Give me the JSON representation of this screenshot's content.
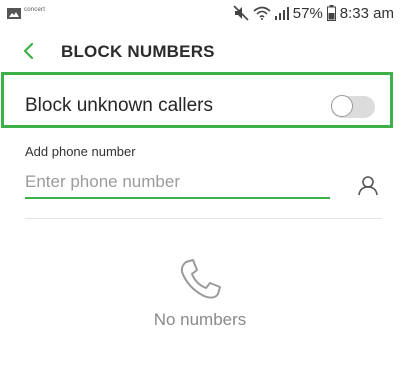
{
  "status_bar": {
    "notification_text": "concert",
    "battery": "57%",
    "time": "8:33 am",
    "icons": [
      "gallery-icon",
      "mute-icon",
      "wifi-icon",
      "signal-icon"
    ]
  },
  "header": {
    "title": "BLOCK NUMBERS",
    "back_icon": "chevron-left-icon"
  },
  "block_unknown": {
    "label": "Block unknown callers",
    "enabled": false
  },
  "add_number": {
    "label": "Add phone number",
    "value": "",
    "placeholder": "Enter phone number",
    "contact_icon": "contact-icon"
  },
  "empty_state": {
    "icon": "phone-icon",
    "text": "No numbers"
  },
  "colors": {
    "accent": "#3db04a",
    "toggle_off_track": "#dcdcdc",
    "placeholder": "#9b9b9b",
    "empty_text": "#8a8a8a"
  }
}
